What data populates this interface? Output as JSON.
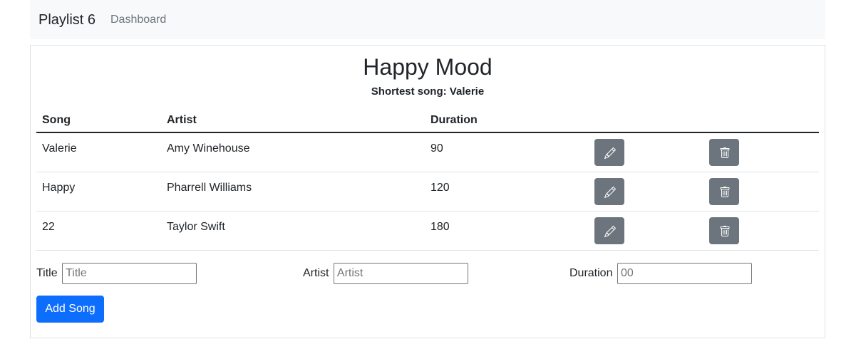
{
  "navbar": {
    "brand": "Playlist 6",
    "link": "Dashboard"
  },
  "playlist": {
    "title": "Happy Mood",
    "shortest_label": "Shortest song: Valerie"
  },
  "table": {
    "headers": [
      "Song",
      "Artist",
      "Duration"
    ],
    "rows": [
      {
        "song": "Valerie",
        "artist": "Amy Winehouse",
        "duration": "90"
      },
      {
        "song": "Happy",
        "artist": "Pharrell Williams",
        "duration": "120"
      },
      {
        "song": "22",
        "artist": "Taylor Swift",
        "duration": "180"
      }
    ],
    "edit_icon": "pencil-icon",
    "delete_icon": "trash-icon"
  },
  "form": {
    "title_label": "Title",
    "title_placeholder": "Title",
    "artist_label": "Artist",
    "artist_placeholder": "Artist",
    "duration_label": "Duration",
    "duration_placeholder": "00",
    "submit_label": "Add Song"
  },
  "colors": {
    "navbar_bg": "#f8f9fa",
    "primary": "#0d6efd",
    "secondary": "#6c757d"
  }
}
